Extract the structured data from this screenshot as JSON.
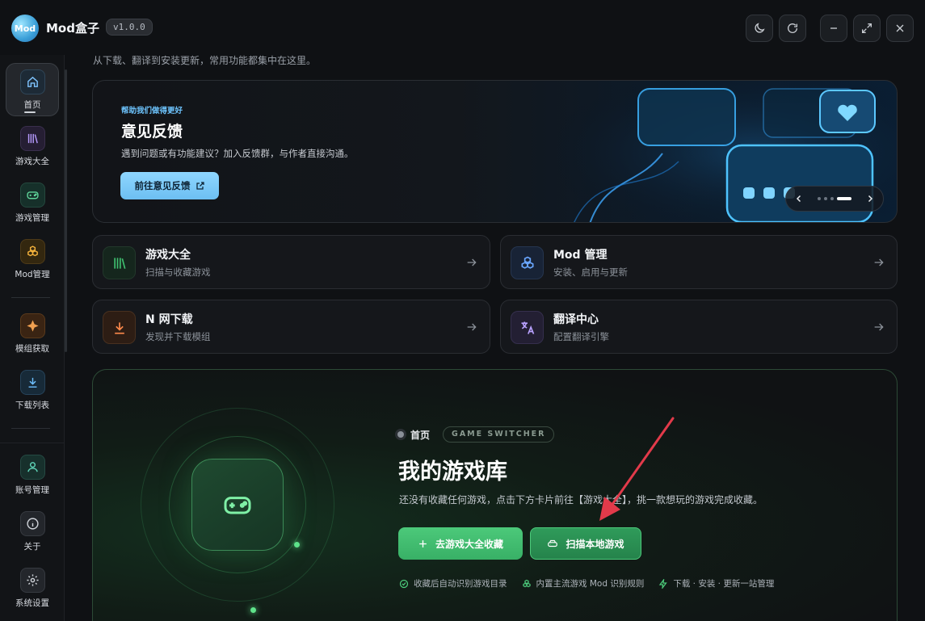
{
  "app": {
    "logo_text": "Mod",
    "title": "Mod盒子",
    "version": "v1.0.0"
  },
  "window_controls": [
    "theme-toggle",
    "refresh",
    "minimize",
    "maximize",
    "close"
  ],
  "sidebar": {
    "items": [
      {
        "label": "首页",
        "icon": "home-icon",
        "active": true
      },
      {
        "label": "游戏大全",
        "icon": "library-icon"
      },
      {
        "label": "游戏管理",
        "icon": "gamepad-icon"
      },
      {
        "label": "Mod管理",
        "icon": "cubes-icon"
      },
      {
        "label": "模组获取",
        "icon": "nexus-icon"
      },
      {
        "label": "下载列表",
        "icon": "download-icon"
      },
      {
        "label": "账号管理",
        "icon": "user-icon"
      },
      {
        "label": "关于",
        "icon": "info-icon"
      },
      {
        "label": "系统设置",
        "icon": "gear-icon"
      }
    ]
  },
  "main": {
    "subtitle": "从下载、翻译到安装更新，常用功能都集中在这里。",
    "banner": {
      "kicker": "帮助我们做得更好",
      "title": "意见反馈",
      "description": "遇到问题或有功能建议？加入反馈群，与作者直接沟通。",
      "button_label": "前往意见反馈",
      "carousel_index": 4,
      "carousel_count": 4
    },
    "cards": [
      {
        "title": "游戏大全",
        "subtitle": "扫描与收藏游戏",
        "icon": "library-icon",
        "accent": "#3fbf6f"
      },
      {
        "title": "Mod 管理",
        "subtitle": "安装、启用与更新",
        "icon": "cubes-icon",
        "accent": "#6aa7ff"
      },
      {
        "title": "N 网下载",
        "subtitle": "发现并下载模组",
        "icon": "download-icon",
        "accent": "#ff8a4c"
      },
      {
        "title": "翻译中心",
        "subtitle": "配置翻译引擎",
        "icon": "translate-icon",
        "accent": "#b9a2ff"
      }
    ],
    "library": {
      "tag": "首页",
      "chip": "GAME SWITCHER",
      "title": "我的游戏库",
      "description": "还没有收藏任何游戏，点击下方卡片前往【游戏大全】，挑一款想玩的游戏完成收藏。",
      "primary_button": "去游戏大全收藏",
      "secondary_button": "扫描本地游戏",
      "features": [
        "收藏后自动识别游戏目录",
        "内置主流游戏 Mod 识别规则",
        "下载 · 安装 · 更新一站管理"
      ]
    }
  },
  "colors": {
    "accent_green": "#4cc97a",
    "accent_blue": "#8fd6ff",
    "annotation_arrow": "#e23a4a"
  }
}
